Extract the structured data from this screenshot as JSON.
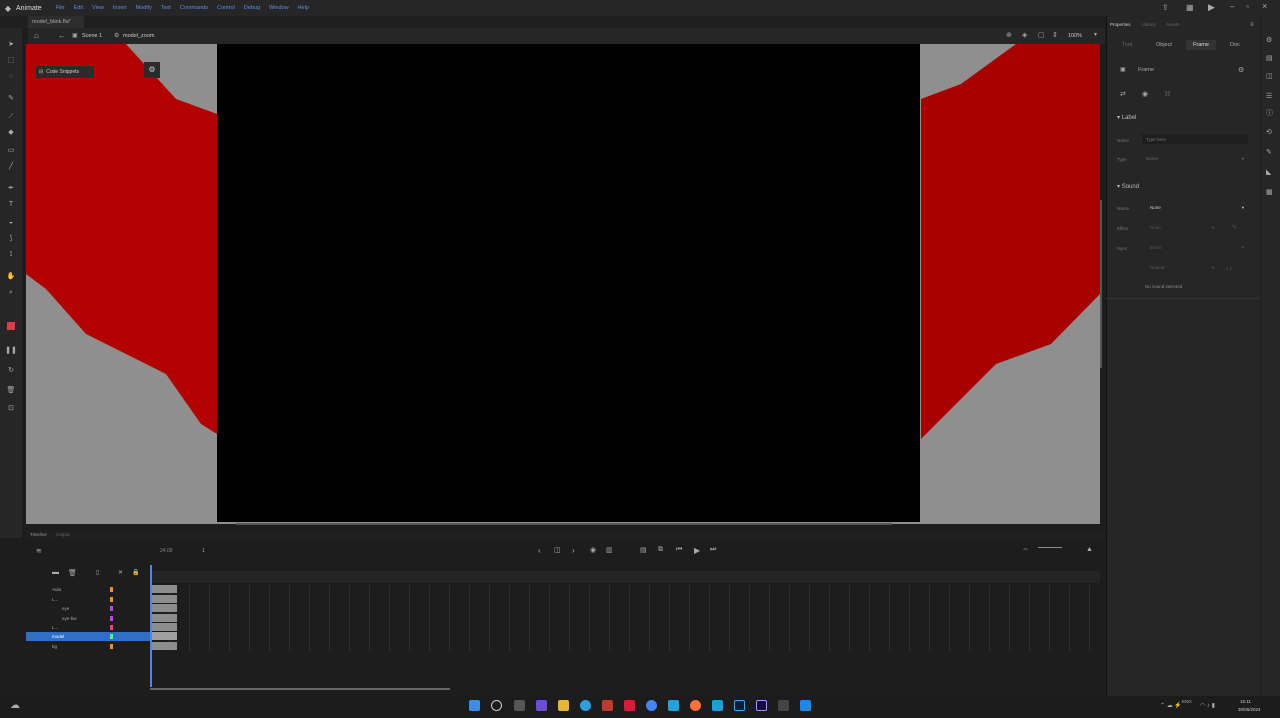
{
  "app": {
    "name": "Animate",
    "menu": [
      "File",
      "Edit",
      "View",
      "Insert",
      "Modify",
      "Text",
      "Commands",
      "Control",
      "Debug",
      "Window",
      "Help"
    ]
  },
  "document": {
    "tab_label": "model_blink.fla*",
    "breadcrumb_scene": "Scene 1",
    "breadcrumb_symbol": "model_zoom",
    "zoom": "100%"
  },
  "stage": {
    "code_snippets_label": "Code Snippets",
    "colors": {
      "background": "#8f8f8f",
      "red": "#c00000",
      "black": "#000000"
    }
  },
  "timeline": {
    "tabs": [
      "Timeline",
      "Output"
    ],
    "fps": "24.00",
    "frame": "1",
    "layers": [
      {
        "name": "Aula",
        "color": "#ff8c1a"
      },
      {
        "name": "L...",
        "color": "#ff8c1a"
      },
      {
        "name": "eye",
        "color": "#c040ff"
      },
      {
        "name": "eye-bw",
        "color": "#c040ff"
      },
      {
        "name": "L...",
        "color": "#ff3a8c"
      },
      {
        "name": "model",
        "color": "#44ff88"
      },
      {
        "name": "bg",
        "color": "#ff8c1a"
      }
    ],
    "selected_layer": 5
  },
  "properties": {
    "tabs": [
      "Properties",
      "Library",
      "Assets"
    ],
    "subtabs": [
      "Tool",
      "Object",
      "Frame",
      "Doc"
    ],
    "active_subtab": "Frame",
    "panel_title": "Frame",
    "label": {
      "section": "Label",
      "name_label": "Name",
      "name_placeholder": "Type here",
      "type_label": "Type",
      "type_value": "Name"
    },
    "sound": {
      "section": "Sound",
      "name_label": "Name",
      "name_value": "None",
      "effect_label": "Effect",
      "effect_value": "None",
      "sync_label": "Sync",
      "sync_value": "Event",
      "repeat_value": "Repeat",
      "repeat_count": "x 1",
      "status": "No sound selected"
    }
  },
  "taskbar": {
    "lang": "ENG",
    "time": "15:11",
    "date": "30/06/2024"
  }
}
